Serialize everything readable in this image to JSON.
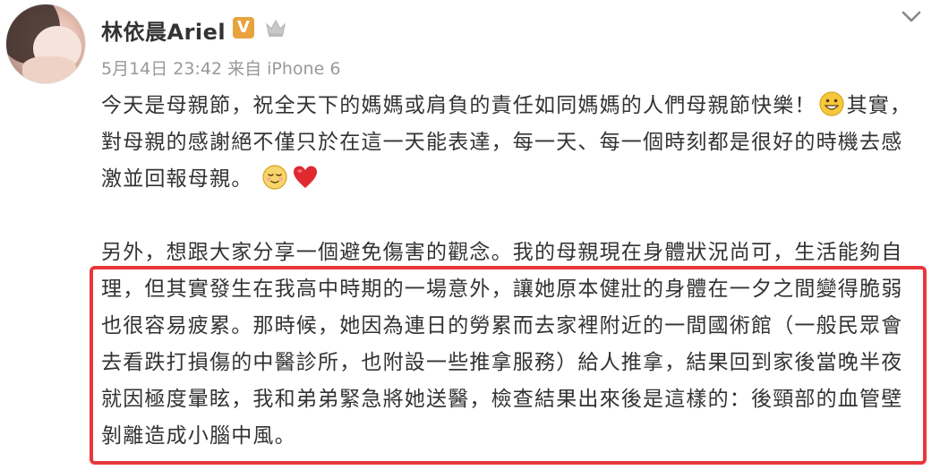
{
  "post": {
    "username": "林依晨Ariel",
    "verified_badge": "V",
    "member_icon": "crown-icon",
    "options_icon": "chevron-down-icon",
    "meta": "5月14日 23:42 来自 iPhone 6",
    "paragraph1_part1": "今天是母親節，祝全天下的媽媽或肩負的責任如同媽媽的人們母親節快樂！",
    "paragraph1_part2": "其實，對母親的感謝絕不僅只於在這一天能表達，每一天、每一個時刻都是很好的時機去感激並回報母親。",
    "paragraph2": "另外，想跟大家分享一個避免傷害的觀念。我的母親現在身體狀況尚可，生活能夠自理，但其實發生在我高中時期的一場意外，讓她原本健壯的身體在一夕之間變得脆弱也很容易疲累。那時候，她因為連日的勞累而去家裡附近的一間國術館（一般民眾會去看跌打損傷的中醫診所，也附設一些推拿服務）給人推拿，結果回到家後當晚半夜就因極度暈眩，我和弟弟緊急將她送醫，檢查結果出來後是這樣的：後頸部的血管壁剝離造成小腦中風。",
    "emoji": [
      "grin-emoji",
      "relieved-emoji",
      "heart-emoji"
    ],
    "highlight_color": "#e8373c",
    "badge_color": "#e8a33d"
  }
}
